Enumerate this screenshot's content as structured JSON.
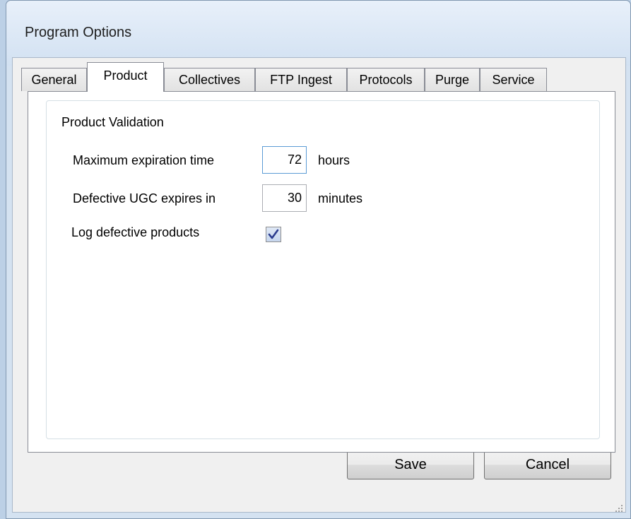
{
  "window": {
    "title": "Program Options"
  },
  "tabs": [
    {
      "label": "General",
      "active": false
    },
    {
      "label": "Product",
      "active": true
    },
    {
      "label": "Collectives",
      "active": false
    },
    {
      "label": "FTP Ingest",
      "active": false
    },
    {
      "label": "Protocols",
      "active": false
    },
    {
      "label": "Purge",
      "active": false
    },
    {
      "label": "Service",
      "active": false
    }
  ],
  "product_validation": {
    "title": "Product Validation",
    "max_expiration": {
      "label": "Maximum expiration time",
      "value": "72",
      "unit": "hours"
    },
    "defective_ugc": {
      "label": "Defective UGC expires in",
      "value": "30",
      "unit": "minutes"
    },
    "log_defective": {
      "label": "Log defective products",
      "checked": true
    }
  },
  "buttons": {
    "save": "Save",
    "cancel": "Cancel"
  },
  "icons": {
    "checkmark": "check-icon",
    "resize_grip": "resize-grip-icon"
  },
  "colors": {
    "window_frame": "#d4e2f1",
    "client_bg": "#f0f0f0",
    "tab_page_bg": "#ffffff",
    "focus_border": "#5b9bd5",
    "check_color": "#2b3c8f"
  }
}
